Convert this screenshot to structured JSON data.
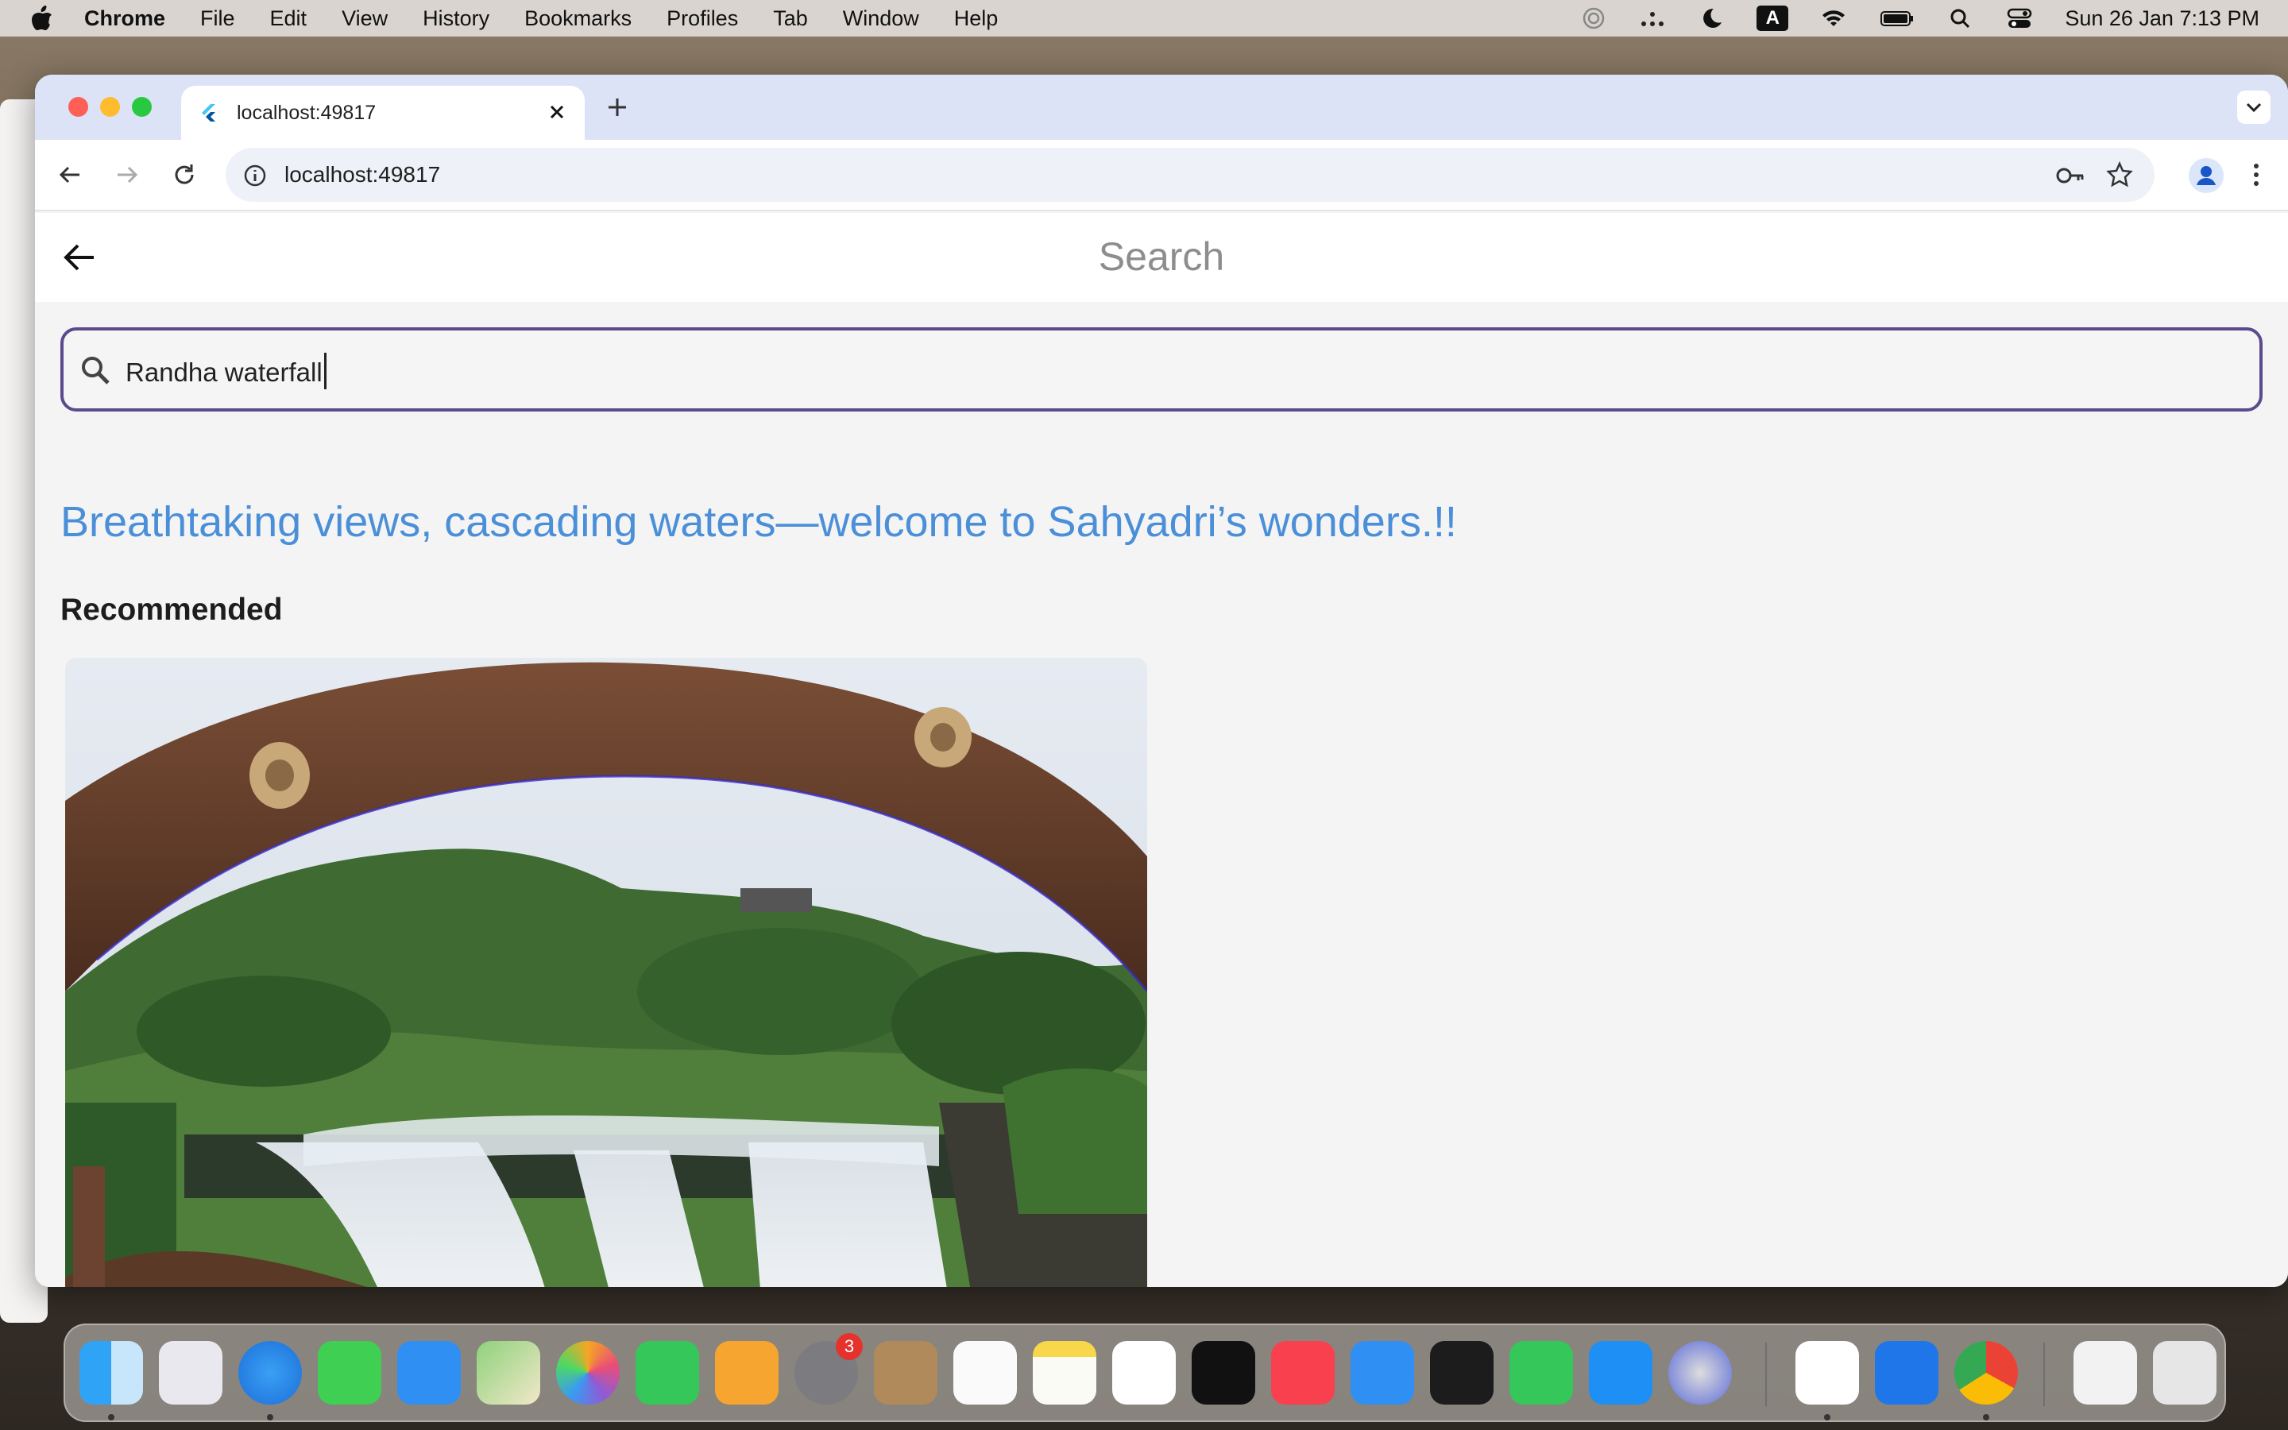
{
  "menubar": {
    "app_name": "Chrome",
    "items": [
      "File",
      "Edit",
      "View",
      "History",
      "Bookmarks",
      "Profiles",
      "Tab",
      "Window",
      "Help"
    ],
    "input_indicator": "A",
    "clock": "Sun 26 Jan  7:13 PM"
  },
  "browser": {
    "tab_title": "localhost:49817",
    "url": "localhost:49817"
  },
  "page": {
    "appbar_title": "Search",
    "search_value": "Randha waterfall",
    "tagline": "Breathtaking views, cascading waters—welcome to Sahyadri’s wonders.!!",
    "section_title": "Recommended"
  },
  "dock": {
    "settings_badge": "3",
    "apps": [
      "finder",
      "launchpad",
      "safari",
      "messages",
      "mail",
      "maps",
      "photos",
      "facetime",
      "pages",
      "system-settings",
      "contacts",
      "reminders",
      "notes",
      "freeform",
      "tv",
      "music",
      "keynote",
      "terminal",
      "numbers",
      "app-store",
      "screen-capture",
      "vscode",
      "xcode",
      "chrome",
      "archive",
      "trash"
    ]
  }
}
